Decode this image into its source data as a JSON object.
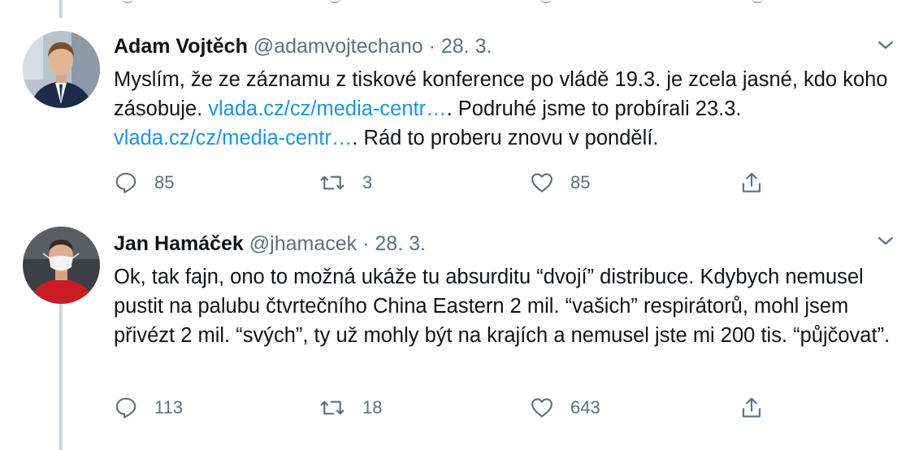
{
  "tweets": [
    {
      "author_name": "Adam Vojtěch",
      "handle": "@adamvojtechano",
      "separator": "·",
      "date": "28. 3.",
      "text_part1": "Myslím, že ze záznamu z tiskové konference po vládě 19.3. je zcela jasné, kdo koho zásobuje. ",
      "link1": "vlada.cz/cz/media-centr…",
      "text_part2": ". Podruhé jsme to probírali 23.3. ",
      "link2": "vlada.cz/cz/media-centr…",
      "text_part3": ". Rád to proberu znovu v pondělí.",
      "replies": "85",
      "retweets": "3",
      "likes": "85",
      "icons": {
        "reply": "reply-icon",
        "retweet": "retweet-icon",
        "like": "heart-icon",
        "share": "share-icon",
        "menu": "chevron-down-icon"
      }
    },
    {
      "author_name": "Jan Hamáček",
      "handle": "@jhamacek",
      "separator": "·",
      "date": "28. 3.",
      "text": "Ok, tak fajn, ono to možná ukáže tu absurditu “dvojí” distribuce. Kdybych nemusel pustit na palubu čtvrtečního China Eastern 2 mil. “vašich” respirátorů, mohl jsem přivézt 2 mil. “svých”, ty už mohly být na krajích a nemusel jste mi 200 tis. “půjčovat”.",
      "replies": "113",
      "retweets": "18",
      "likes": "643",
      "icons": {
        "reply": "reply-icon",
        "retweet": "retweet-icon",
        "like": "heart-icon",
        "share": "share-icon",
        "menu": "chevron-down-icon"
      }
    }
  ],
  "colors": {
    "link": "#1b95e0",
    "secondary": "#5b7083",
    "text": "#0f1419",
    "thread_line": "#ccd6dd"
  }
}
